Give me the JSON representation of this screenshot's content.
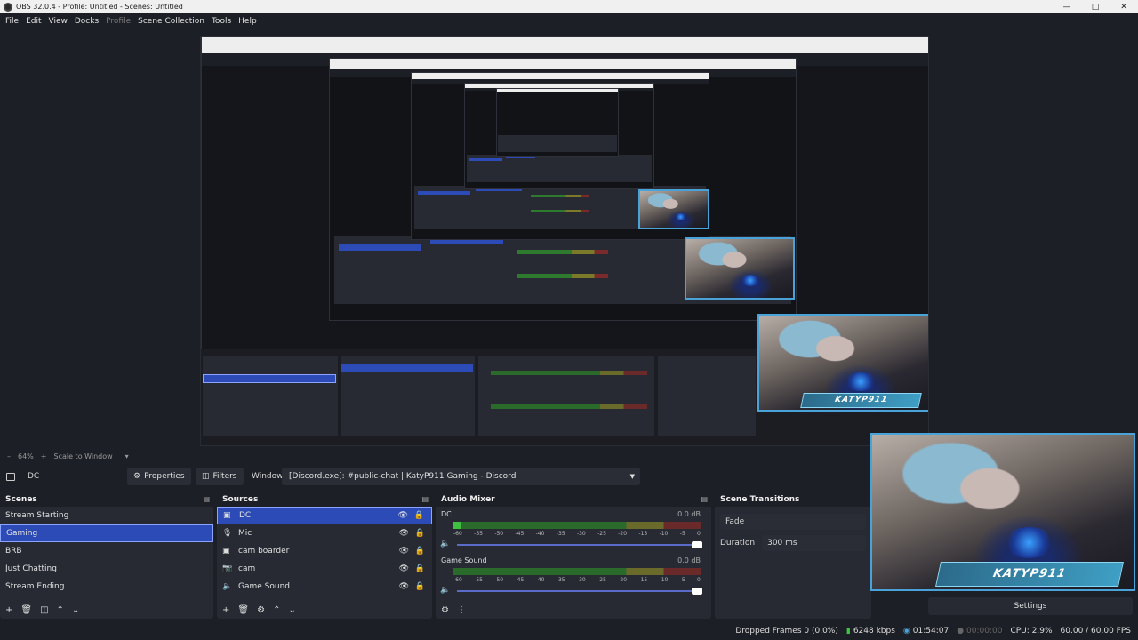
{
  "window": {
    "title": "OBS 32.0.4 - Profile: Untitled - Scenes: Untitled",
    "controls": [
      "minimize",
      "maximize",
      "close"
    ]
  },
  "menu": [
    "File",
    "Edit",
    "View",
    "Docks",
    "Profile",
    "Scene Collection",
    "Tools",
    "Help"
  ],
  "preview": {
    "zoom": "64%",
    "scale_mode": "Scale to Window",
    "webcam_label": "KATYP911"
  },
  "context": {
    "source_name": "DC",
    "properties_label": "Properties",
    "filters_label": "Filters",
    "window_label": "Window",
    "window_value": "[Discord.exe]: #public-chat | KatyP911 Gaming - Discord"
  },
  "scenes": {
    "title": "Scenes",
    "items": [
      "Stream Starting",
      "Gaming",
      "BRB",
      "Just Chatting",
      "Stream Ending"
    ],
    "selected": "Gaming"
  },
  "sources": {
    "title": "Sources",
    "items": [
      {
        "name": "DC",
        "icon": "window-capture-icon",
        "selected": true
      },
      {
        "name": "Mic",
        "icon": "microphone-icon",
        "selected": false
      },
      {
        "name": "cam boarder",
        "icon": "image-icon",
        "selected": false
      },
      {
        "name": "cam",
        "icon": "camera-icon",
        "selected": false
      },
      {
        "name": "Game Sound",
        "icon": "speaker-icon",
        "selected": false
      }
    ]
  },
  "audio_mixer": {
    "title": "Audio Mixer",
    "ticks": [
      "-60",
      "-55",
      "-50",
      "-45",
      "-40",
      "-35",
      "-30",
      "-25",
      "-20",
      "-15",
      "-10",
      "-5",
      "0"
    ],
    "channels": [
      {
        "name": "DC",
        "db": "0.0 dB",
        "level": 0.03
      },
      {
        "name": "Game Sound",
        "db": "0.0 dB",
        "level": 0.0
      }
    ]
  },
  "scene_transitions": {
    "title": "Scene Transitions",
    "transition": "Fade",
    "duration_label": "Duration",
    "duration_value": "300 ms"
  },
  "settings_label": "Settings",
  "status": {
    "dropped_frames": "Dropped Frames 0 (0.0%)",
    "bitrate": "6248 kbps",
    "live_time": "01:54:07",
    "rec_time": "00:00:00",
    "cpu": "CPU: 2.9%",
    "fps": "60.00 / 60.00 FPS"
  }
}
